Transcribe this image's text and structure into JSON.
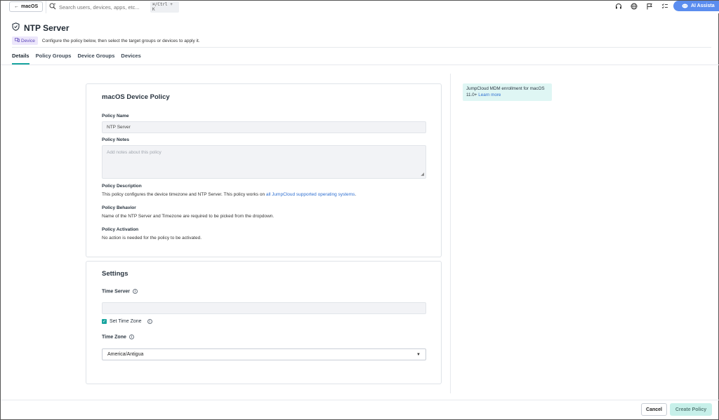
{
  "topbar": {
    "back_label": "macOS",
    "search_placeholder": "Search users, devices, apps, etc...",
    "shortcut": "⌘/Ctrl + K",
    "ai_label": "AI Assista"
  },
  "header": {
    "title": "NTP Server",
    "badge": "Device",
    "subtitle": "Configure the policy below, then select the target groups or devices to apply it."
  },
  "tabs": [
    {
      "label": "Details",
      "active": true
    },
    {
      "label": "Policy Groups"
    },
    {
      "label": "Device Groups"
    },
    {
      "label": "Devices"
    }
  ],
  "policy_card": {
    "title": "macOS Device Policy",
    "name_label": "Policy Name",
    "name_value": "NTP Server",
    "notes_label": "Policy Notes",
    "notes_placeholder": "Add notes about this policy",
    "description_label": "Policy Description",
    "description_text": "This policy configures the device timezone and NTP Server. This policy works on ",
    "description_link": "all JumpCloud supported operating systems",
    "description_end": ".",
    "behavior_label": "Policy Behavior",
    "behavior_text": "Name of the NTP Server and Timezone are required to be picked from the dropdown.",
    "activation_label": "Policy Activation",
    "activation_text": "No action is needed for the policy to be activated."
  },
  "settings_card": {
    "title": "Settings",
    "time_server_label": "Time Server",
    "time_server_value": "",
    "set_timezone_label": "Set Time Zone",
    "set_timezone_checked": true,
    "timezone_label": "Time Zone",
    "timezone_value": "America/Antigua"
  },
  "info_box": {
    "text": "JumpCloud MDM enrollment for macOS 11.0+ ",
    "link": "Learn more"
  },
  "footer": {
    "cancel_label": "Cancel",
    "create_label": "Create Policy"
  },
  "colors": {
    "accent": "#19a5a0",
    "link": "#2e6fd1",
    "ai_button": "#5b8def"
  }
}
